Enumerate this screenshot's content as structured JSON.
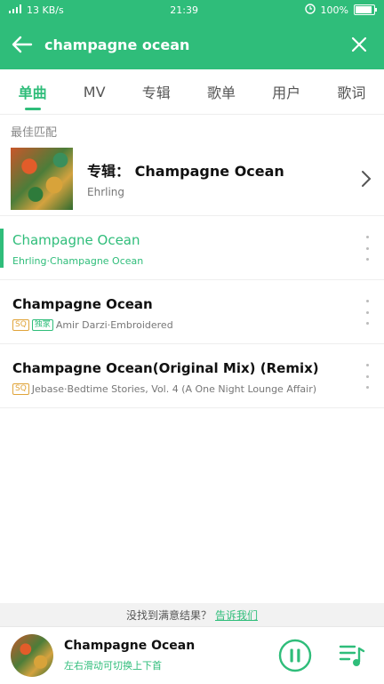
{
  "status_bar": {
    "network": "13 KB/s",
    "time": "21:39",
    "battery": "100%",
    "battery_level": 1.0
  },
  "search": {
    "query": "champagne ocean"
  },
  "tabs": [
    {
      "label": "单曲",
      "active": true
    },
    {
      "label": "MV",
      "active": false
    },
    {
      "label": "专辑",
      "active": false
    },
    {
      "label": "歌单",
      "active": false
    },
    {
      "label": "用户",
      "active": false
    },
    {
      "label": "歌词",
      "active": false
    }
  ],
  "best_match": {
    "section_label": "最佳匹配",
    "title": "专辑： Champagne Ocean",
    "artist": "Ehrling"
  },
  "songs": [
    {
      "title": "Champagne Ocean",
      "meta": "Ehrling·Champagne Ocean",
      "playing": true,
      "badges": []
    },
    {
      "title": "Champagne Ocean",
      "meta": "Amir Darzi·Embroidered",
      "playing": false,
      "badges": [
        "SQ",
        "独家"
      ]
    },
    {
      "title": "Champagne Ocean(Original Mix) (Remix)",
      "meta": "Jebase·Bedtime Stories, Vol. 4 (A One Night Lounge Affair)",
      "playing": false,
      "badges": [
        "SQ"
      ]
    }
  ],
  "feedback": {
    "text": "没找到满意结果？",
    "link": "告诉我们"
  },
  "player": {
    "title": "Champagne Ocean",
    "hint": "左右滑动可切换上下首"
  },
  "colors": {
    "accent": "#2fbd7a",
    "sq_badge": "#e0a43a"
  },
  "icons": {
    "back": "arrow-left-icon",
    "close": "close-icon",
    "chevron": "chevron-right-icon",
    "more": "more-vertical-icon",
    "pause": "pause-icon",
    "playlist": "playlist-icon"
  }
}
